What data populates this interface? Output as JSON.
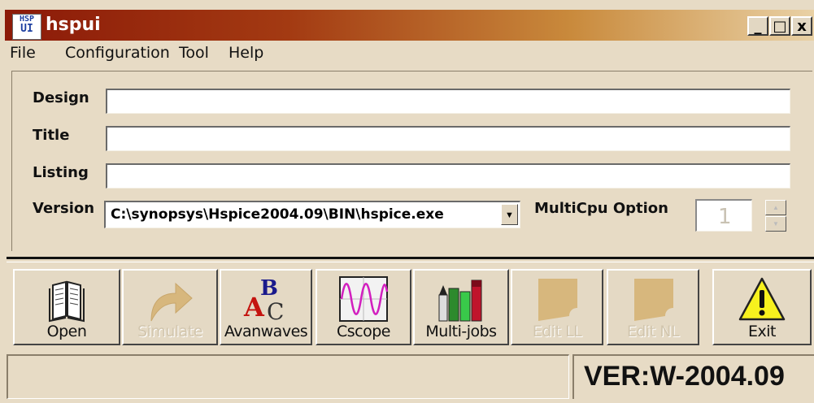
{
  "window": {
    "icon_text_top": "HSP",
    "icon_text_bottom": "UI",
    "title": "hspui",
    "minimize_glyph": "_",
    "maximize_glyph": "□",
    "close_glyph": "x"
  },
  "menu": [
    "File",
    "Configuration",
    "Tool",
    "Help"
  ],
  "form": {
    "design_label": "Design",
    "design_value": "",
    "title_label": "Title",
    "title_value": "",
    "listing_label": "Listing",
    "listing_value": "",
    "version_label": "Version",
    "version_value": "C:\\synopsys\\Hspice2004.09\\BIN\\hspice.exe",
    "multicpu_label": "MultiCpu Option",
    "multicpu_value": "1"
  },
  "toolbar": [
    {
      "label": "Open",
      "icon": "open-book-icon",
      "enabled": true
    },
    {
      "label": "Simulate",
      "icon": "simulate-arrow-icon",
      "enabled": false
    },
    {
      "label": "Avanwaves",
      "icon": "avanwaves-letters-icon",
      "enabled": true
    },
    {
      "label": "Cscope",
      "icon": "cscope-waveform-icon",
      "enabled": true
    },
    {
      "label": "Multi-jobs",
      "icon": "multi-jobs-icon",
      "enabled": true
    },
    {
      "label": "Edit LL",
      "icon": "edit-ll-page-icon",
      "enabled": false
    },
    {
      "label": "Edit NL",
      "icon": "edit-nl-page-icon",
      "enabled": false
    },
    {
      "label": "Exit",
      "icon": "warning-exit-icon",
      "enabled": true
    }
  ],
  "status": {
    "left_text": "",
    "version": "VER:W-2004.09"
  },
  "colors": {
    "titlebar_start": "#8c1a08",
    "titlebar_end": "#e9d1a5",
    "face": "#e7dbc5",
    "disabled_text": "#d2c6ae"
  }
}
